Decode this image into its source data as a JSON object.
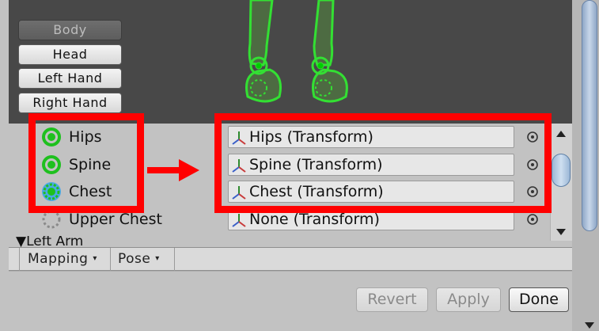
{
  "body_buttons": [
    {
      "label": "Body",
      "active": true
    },
    {
      "label": "Head",
      "active": false
    },
    {
      "label": "Left Hand",
      "active": false
    },
    {
      "label": "Right Hand",
      "active": false
    }
  ],
  "bones": [
    {
      "label": "Hips",
      "icon": "filled-circle-icon",
      "field": "Hips (Transform)"
    },
    {
      "label": "Spine",
      "icon": "filled-circle-icon",
      "field": "Spine (Transform)"
    },
    {
      "label": "Chest",
      "icon": "dotted-selected-circle-icon",
      "field": "Chest (Transform)"
    },
    {
      "label": "Upper Chest",
      "icon": "dashed-circle-icon",
      "field": "None (Transform)"
    }
  ],
  "partial_row": "Left Arm",
  "tabs": {
    "mapping": "Mapping",
    "pose": "Pose"
  },
  "actions": {
    "revert": "Revert",
    "apply": "Apply",
    "done": "Done"
  },
  "colors": {
    "annotation": "#ff0000",
    "bone_green": "#22c022"
  }
}
